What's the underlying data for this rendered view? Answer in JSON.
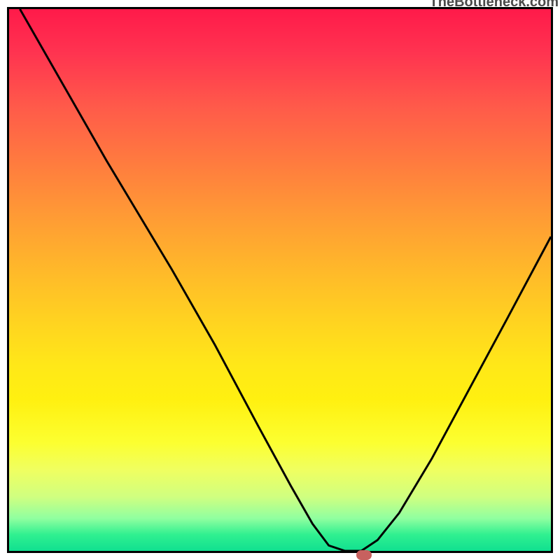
{
  "watermark": "TheBottleneck.com",
  "chart_data": {
    "type": "line",
    "title": "",
    "xlabel": "",
    "ylabel": "",
    "xlim": [
      0,
      100
    ],
    "ylim": [
      0,
      100
    ],
    "series": [
      {
        "name": "curve",
        "points": [
          {
            "x": 2,
            "y": 100
          },
          {
            "x": 10,
            "y": 86
          },
          {
            "x": 18,
            "y": 72
          },
          {
            "x": 24,
            "y": 62
          },
          {
            "x": 30,
            "y": 52
          },
          {
            "x": 38,
            "y": 38
          },
          {
            "x": 46,
            "y": 23
          },
          {
            "x": 52,
            "y": 12
          },
          {
            "x": 56,
            "y": 5
          },
          {
            "x": 59,
            "y": 1
          },
          {
            "x": 62,
            "y": 0
          },
          {
            "x": 65,
            "y": 0
          },
          {
            "x": 68,
            "y": 2
          },
          {
            "x": 72,
            "y": 7
          },
          {
            "x": 78,
            "y": 17
          },
          {
            "x": 85,
            "y": 30
          },
          {
            "x": 92,
            "y": 43
          },
          {
            "x": 100,
            "y": 58
          }
        ]
      }
    ],
    "marker": {
      "x": 65,
      "y": 0
    },
    "gradient_stops": [
      {
        "pos": 0,
        "color": "#ff1a4a"
      },
      {
        "pos": 50,
        "color": "#ffd020"
      },
      {
        "pos": 80,
        "color": "#fcff30"
      },
      {
        "pos": 100,
        "color": "#10e090"
      }
    ]
  }
}
